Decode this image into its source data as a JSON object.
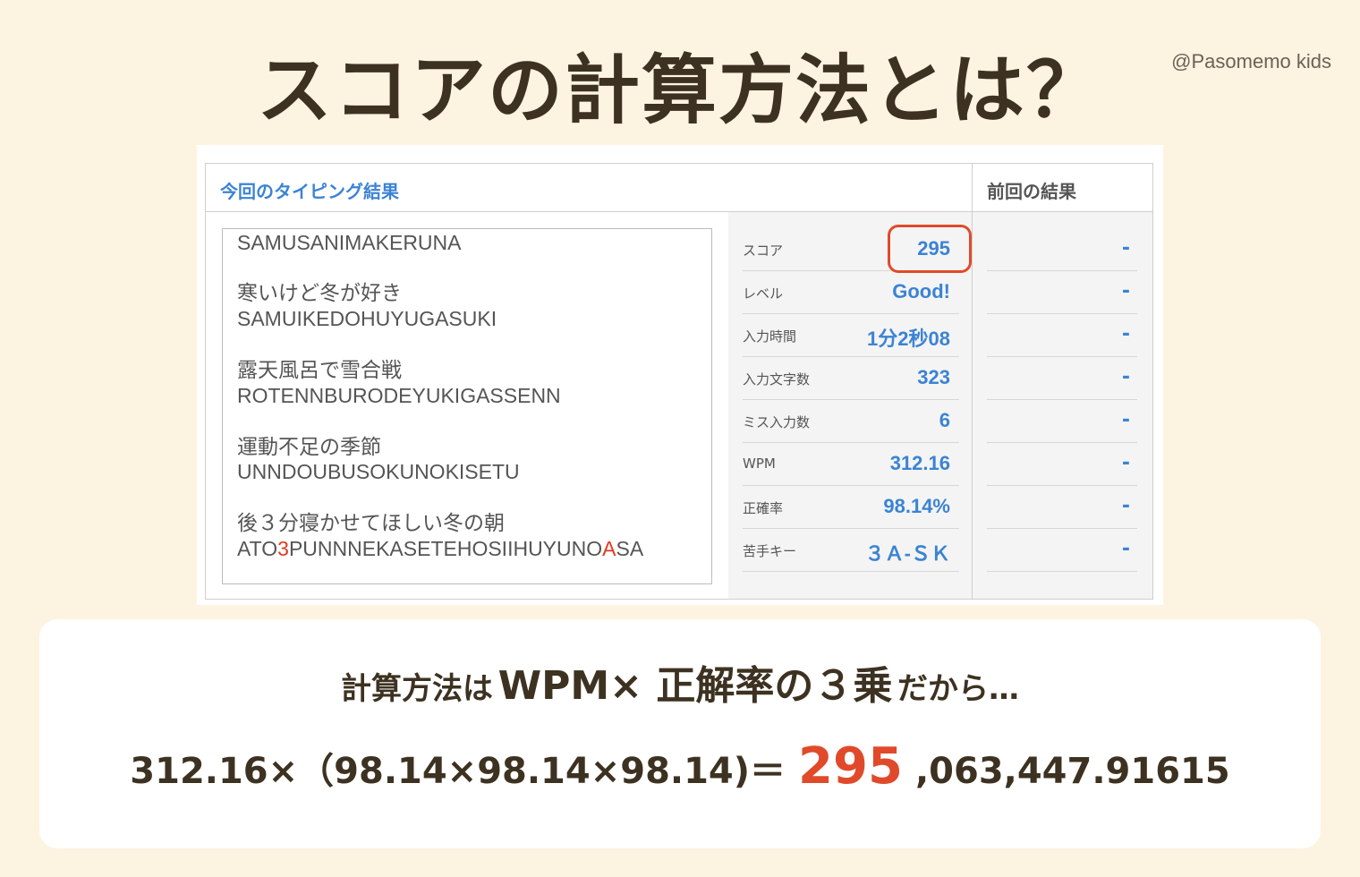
{
  "title": "スコアの計算方法とは？",
  "watermark": "@Pasomemo kids",
  "result_panel": {
    "current_header": "今回のタイピング結果",
    "previous_header": "前回の結果",
    "text_lines": [
      "SAMUSANIMAKERUNA",
      "寒いけど冬が好き",
      "SAMUIKEDOHUYUGASUKI",
      "露天風呂で雪合戦",
      "ROTENNBURODEYUKIGASSENN",
      "運動不足の季節",
      "UNNDOUBUSOKUNOKISETU",
      "後３分寝かせてほしい冬の朝"
    ],
    "last_line": {
      "part1": "ATO",
      "miss1": "3",
      "part2": "PUNNNEKASETEHOSIIHUYUNO",
      "miss2": "A",
      "part3": "SA"
    },
    "stats": [
      {
        "label": "スコア",
        "value": "295"
      },
      {
        "label": "レベル",
        "value": "Good!"
      },
      {
        "label": "入力時間",
        "value": "1分2秒08"
      },
      {
        "label": "入力文字数",
        "value": "323"
      },
      {
        "label": "ミス入力数",
        "value": "6"
      },
      {
        "label": "WPM",
        "value": "312.16"
      },
      {
        "label": "正確率",
        "value": "98.14%"
      },
      {
        "label": "苦手キー",
        "value": "３Ａ-ＳＫ"
      }
    ],
    "previous_values": [
      "-",
      "-",
      "-",
      "-",
      "-",
      "-",
      "-",
      "-"
    ]
  },
  "explanation": {
    "prefix": "計算方法は",
    "formula_label": "WPM× 正解率の３乗",
    "suffix": "だから…"
  },
  "calculation": {
    "left": "312.16×（98.14×98.14×98.14)＝",
    "highlight": "295",
    "rest": ",063,447.91615"
  },
  "colors": {
    "background": "#fdf3e1",
    "accent_blue": "#3b83d4",
    "highlight_red": "#e04a2a",
    "title_brown": "#3d3221"
  }
}
